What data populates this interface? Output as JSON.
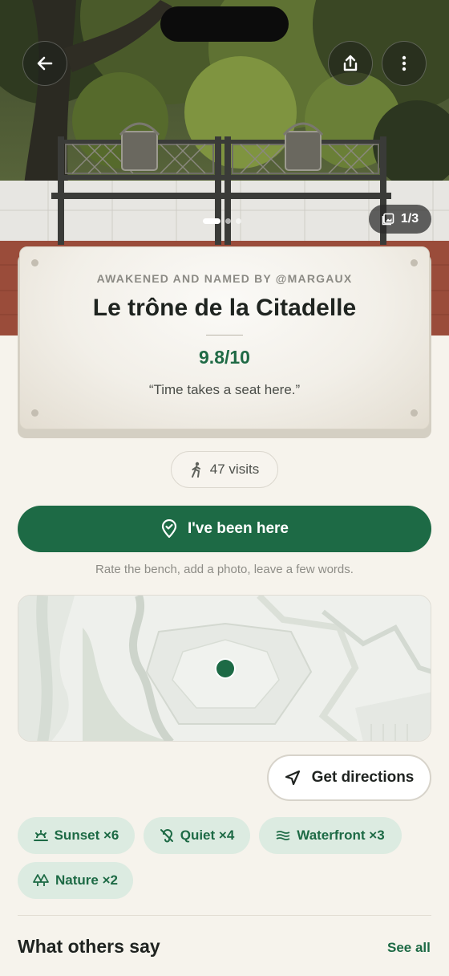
{
  "hero": {
    "photo_alt": "Cast-iron bench in front of trees",
    "image_counter": "1/3",
    "pager": {
      "total": 3,
      "current": 1
    }
  },
  "header": {
    "back_icon": "arrow-left-icon",
    "share_icon": "share-icon",
    "more_icon": "more-vertical-icon"
  },
  "plaque": {
    "overline": "AWAKENED AND NAMED BY @MARGAUX",
    "title": "Le trône de la Citadelle",
    "rating": "9.8/10",
    "quote": "“Time takes a seat here.”"
  },
  "visits": {
    "label": "47 visits",
    "icon": "walking-person-icon"
  },
  "cta": {
    "label": "I've been here",
    "icon": "map-pin-check-icon",
    "hint": "Rate the bench, add a photo, leave a few words."
  },
  "map": {
    "marker": "location-dot"
  },
  "directions": {
    "label": "Get directions",
    "icon": "navigation-arrow-icon"
  },
  "tags": [
    {
      "label": "Sunset ×6",
      "icon": "sunset-icon"
    },
    {
      "label": "Quiet ×4",
      "icon": "mute-ear-icon"
    },
    {
      "label": "Waterfront ×3",
      "icon": "waves-icon"
    },
    {
      "label": "Nature ×2",
      "icon": "trees-icon"
    }
  ],
  "reviews": {
    "title": "What others say",
    "see_all": "See all"
  },
  "colors": {
    "accent": "#1d6a45",
    "background": "#f6f3ec",
    "tag_bg": "#dcebe1"
  }
}
